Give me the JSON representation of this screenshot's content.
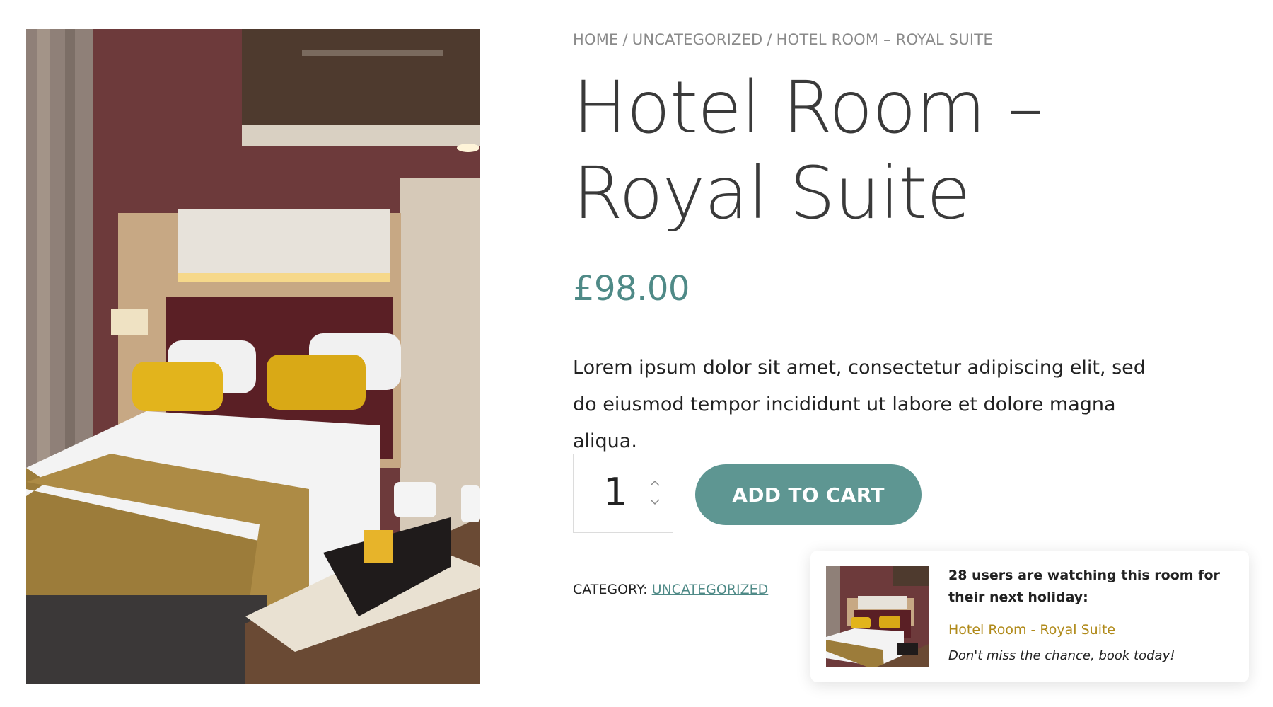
{
  "breadcrumb": {
    "home": "Home",
    "category": "Uncategorized",
    "current": "Hotel Room – Royal Suite",
    "separator": "/"
  },
  "product": {
    "title": "Hotel Room – Royal Suite",
    "price": "£98.00",
    "description": "Lorem ipsum dolor sit amet, consectetur adipiscing elit, sed do eiusmod tempor incididunt ut labore et dolore magna aliqua.",
    "quantity": "1",
    "add_to_cart_label": "Add to cart",
    "category_label": "Category:",
    "category_value": "Uncategorized"
  },
  "popup": {
    "headline": "28 users are watching this room for their next holiday:",
    "product_link": "Hotel Room - Royal Suite",
    "note": "Don't miss the chance, book today!"
  },
  "colors": {
    "accent": "#5e9692",
    "price": "#4f8a87",
    "popup_link": "#b08a1a",
    "title": "#3a3a3a"
  },
  "icons": {
    "qty_up": "chevron-up-icon",
    "qty_down": "chevron-down-icon"
  }
}
